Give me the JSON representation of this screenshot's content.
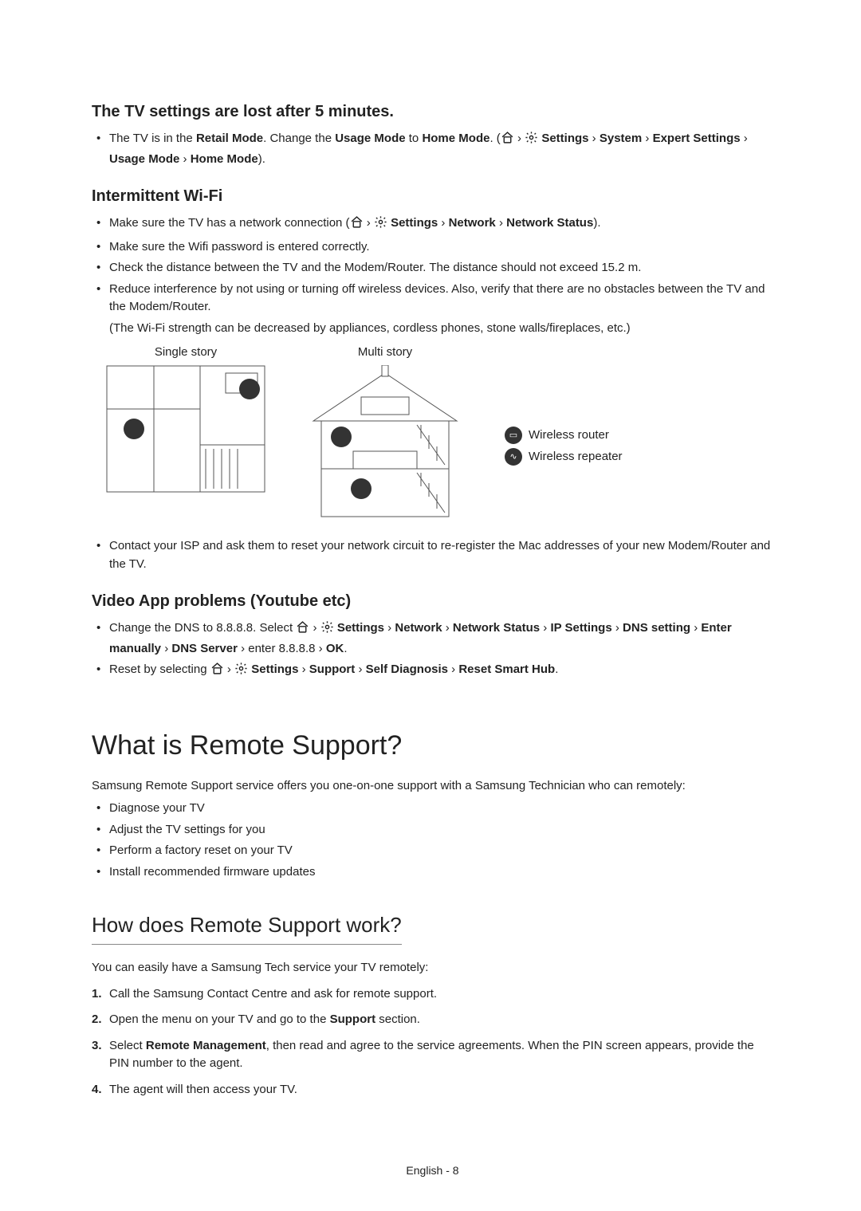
{
  "sec1": {
    "heading": "The TV settings are lost after 5 minutes.",
    "item1_pre": "The TV is in the ",
    "item1_retail": "Retail Mode",
    "item1_mid": ". Change the ",
    "item1_usage": "Usage Mode",
    "item1_to": " to ",
    "item1_home": "Home Mode",
    "item1_open": ". (",
    "item1_gt1": " › ",
    "item1_settings": "Settings",
    "item1_gt2": " › ",
    "item1_system": "System",
    "item1_gt3": " › ",
    "item1_expert": "Expert Settings",
    "item1_gt4": " › ",
    "item1_usage2": "Usage Mode",
    "item1_gt5": " › ",
    "item1_home2": "Home Mode",
    "item1_close": ")."
  },
  "sec2": {
    "heading": "Intermittent Wi-Fi",
    "i1_pre": "Make sure the TV has a network connection (",
    "i1_gt1": " › ",
    "i1_settings": "Settings",
    "i1_gt2": " › ",
    "i1_network": "Network",
    "i1_gt3": " › ",
    "i1_status": "Network Status",
    "i1_close": ").",
    "i2": "Make sure the Wifi password is entered correctly.",
    "i3": "Check the distance between the TV and the Modem/Router. The distance should not exceed 15.2 m.",
    "i4": "Reduce interference by not using or turning off wireless devices. Also, verify that there are no obstacles between the TV and the Modem/Router.",
    "i4b": "(The Wi-Fi strength can be decreased by appliances, cordless phones, stone walls/fireplaces, etc.)",
    "diag_single": "Single story",
    "diag_multi": "Multi story",
    "legend_router": "Wireless router",
    "legend_repeater": "Wireless repeater",
    "i5": "Contact your ISP and ask them to reset your network circuit to re-register the Mac addresses of your new Modem/Router and the TV."
  },
  "sec3": {
    "heading": "Video App problems (Youtube etc)",
    "i1_pre": "Change the DNS to 8.8.8.8. Select ",
    "i1_gt1": " › ",
    "i1_settings": "Settings",
    "i1_gt2": " › ",
    "i1_network": "Network",
    "i1_gt3": " › ",
    "i1_status": "Network Status",
    "i1_gt4": " › ",
    "i1_ip": "IP Settings",
    "i1_gt5": " › ",
    "i1_dns": "DNS setting",
    "i1_gt6": " › ",
    "i1_enter": "Enter manually",
    "i1_gt7": " › ",
    "i1_server": "DNS Server",
    "i1_gt8": " › enter 8.8.8.8 › ",
    "i1_ok": "OK",
    "i1_end": ".",
    "i2_pre": "Reset by selecting ",
    "i2_gt1": " › ",
    "i2_settings": "Settings",
    "i2_gt2": " › ",
    "i2_support": "Support",
    "i2_gt3": " › ",
    "i2_self": "Self Diagnosis",
    "i2_gt4": " › ",
    "i2_reset": "Reset Smart Hub",
    "i2_end": "."
  },
  "sec4": {
    "heading": "What is Remote Support?",
    "intro": "Samsung Remote Support service offers you one-on-one support with a Samsung Technician who can remotely:",
    "b1": "Diagnose your TV",
    "b2": "Adjust the TV settings for you",
    "b3": "Perform a factory reset on your TV",
    "b4": "Install recommended firmware updates"
  },
  "sec5": {
    "heading": "How does Remote Support work?",
    "intro": "You can easily have a Samsung Tech service your TV remotely:",
    "s1": "Call the Samsung Contact Centre and ask for remote support.",
    "s2_pre": "Open the menu on your TV and go to the ",
    "s2_support": "Support",
    "s2_post": " section.",
    "s3_pre": "Select ",
    "s3_rm": "Remote Management",
    "s3_post": ", then read and agree to the service agreements. When the PIN screen appears, provide the PIN number to the agent.",
    "s4": "The agent will then access your TV."
  },
  "footer": "English - 8"
}
